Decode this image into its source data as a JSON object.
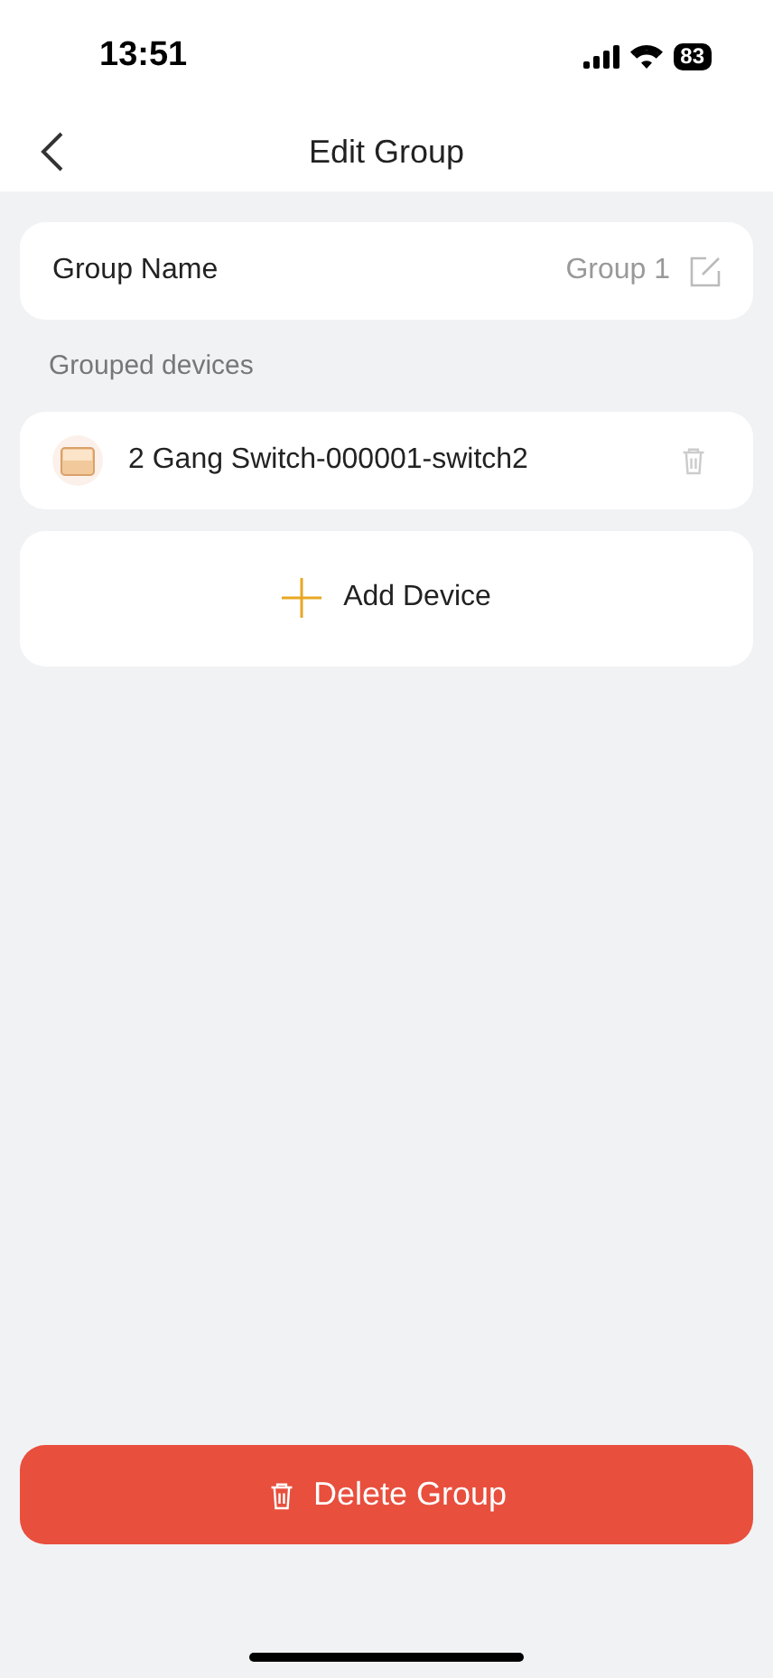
{
  "status_bar": {
    "time": "13:51",
    "battery": "83"
  },
  "header": {
    "title": "Edit Group"
  },
  "group_name": {
    "label": "Group Name",
    "value": "Group 1"
  },
  "section_label": "Grouped devices",
  "devices": [
    {
      "name": "2 Gang Switch-000001-switch2"
    }
  ],
  "add_button": {
    "label": "Add Device"
  },
  "delete_button": {
    "label": "Delete Group"
  }
}
